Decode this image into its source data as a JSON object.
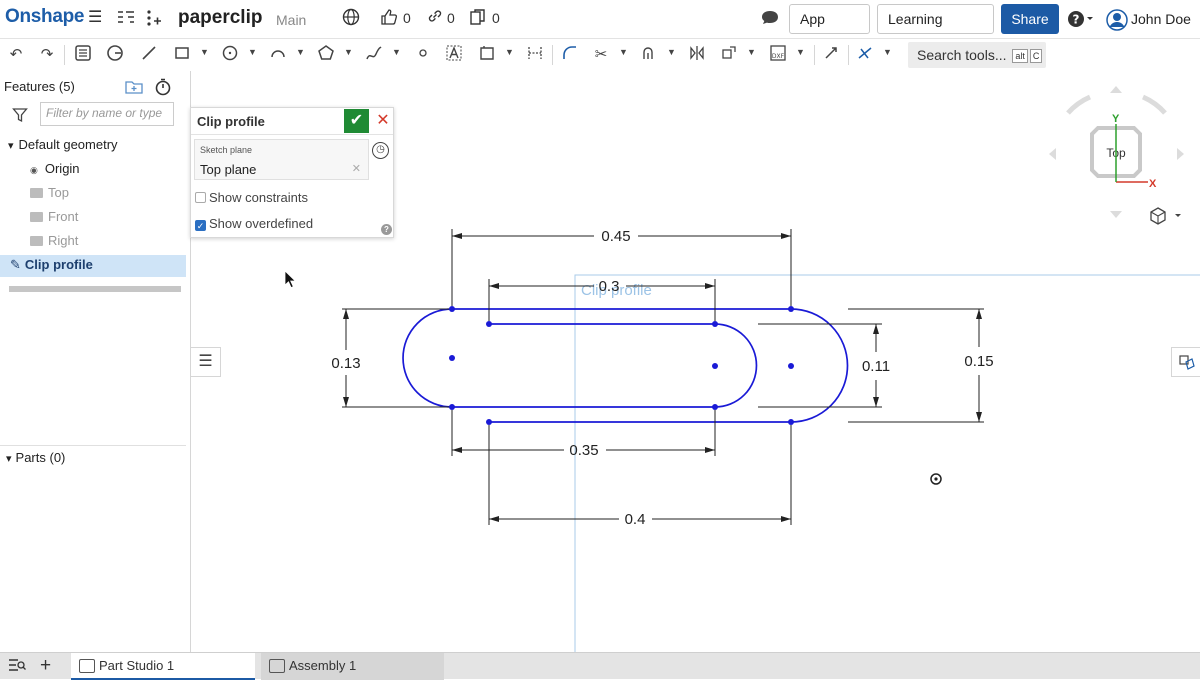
{
  "header": {
    "logo": "Onshape",
    "doc_title": "paperclip",
    "branch": "Main",
    "likes": "0",
    "links": "0",
    "copies": "0",
    "app_store": "App Store",
    "learning_center": "Learning Center",
    "share": "Share",
    "user_name": "John Doe"
  },
  "toolbar": {
    "search_label": "Search tools...",
    "shortcut_alt": "alt",
    "shortcut_key": "C"
  },
  "features": {
    "header": "Features (5)",
    "filter_placeholder": "Filter by name or type",
    "default_geometry": "Default geometry",
    "items": [
      "Origin",
      "Top",
      "Front",
      "Right"
    ],
    "clip_profile": "Clip profile",
    "parts": "Parts (0)"
  },
  "dialog": {
    "title": "Clip profile",
    "sketch_plane_label": "Sketch plane",
    "sketch_plane_value": "Top plane",
    "show_constraints": "Show constraints",
    "show_overdefined": "Show overdefined",
    "show_constraints_checked": false,
    "show_overdefined_checked": true
  },
  "canvas": {
    "sketch_name": "Clip profile",
    "dimensions": {
      "outer_length": "0.45",
      "inner_top_length": "0.3",
      "outer_height": "0.13",
      "inner_height": "0.11",
      "total_height": "0.15",
      "bottom_inner_length": "0.35",
      "bottom_outer_length": "0.4"
    },
    "view_cube": {
      "face": "Top",
      "axis_x": "X",
      "axis_y": "Y"
    }
  },
  "tabs": [
    {
      "label": "Part Studio 1",
      "active": true
    },
    {
      "label": "Assembly 1",
      "active": false
    }
  ],
  "colors": {
    "brand_blue": "#1d5da8",
    "share_blue": "#1c5aa5",
    "sketch_blue": "#1a1ad6",
    "confirm_green": "#1f8a34",
    "cancel_red": "#d43a2b",
    "axis_x_red": "#d43a2b",
    "axis_y_green": "#2ca02c"
  }
}
